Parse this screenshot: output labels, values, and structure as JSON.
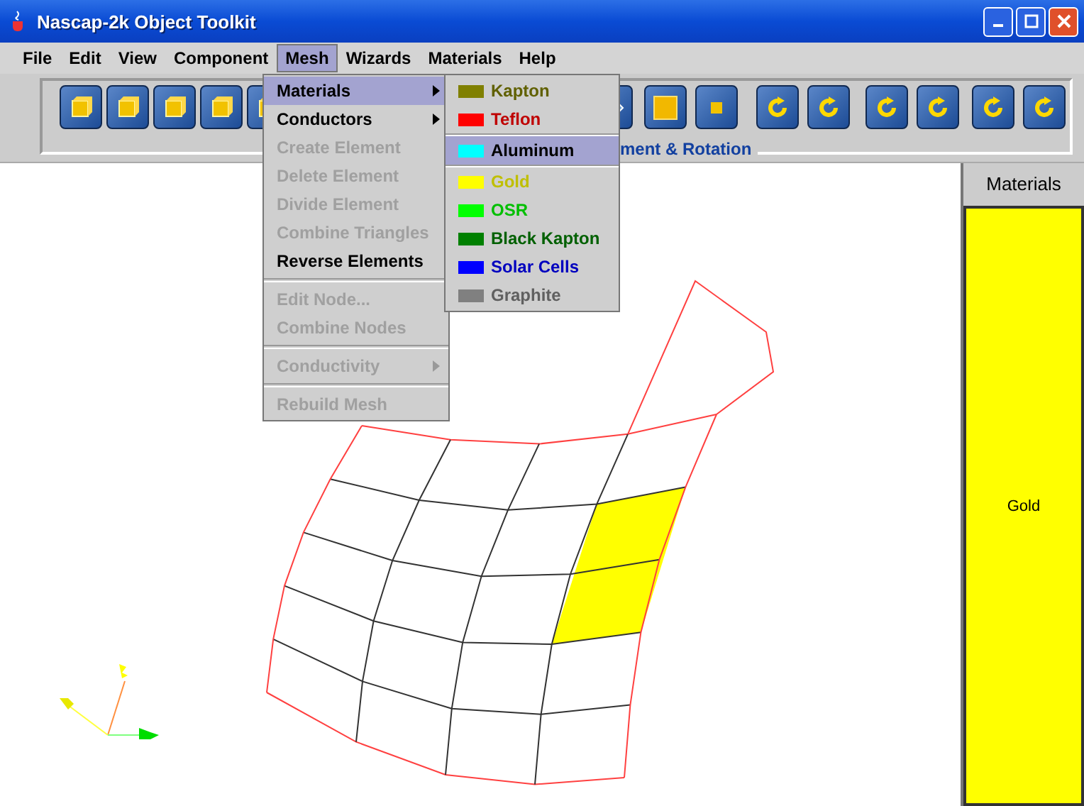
{
  "window": {
    "title": "Nascap-2k Object Toolkit"
  },
  "menubar": [
    {
      "label": "File",
      "selected": false
    },
    {
      "label": "Edit",
      "selected": false
    },
    {
      "label": "View",
      "selected": false
    },
    {
      "label": "Component",
      "selected": false
    },
    {
      "label": "Mesh",
      "selected": true
    },
    {
      "label": "Wizards",
      "selected": false
    },
    {
      "label": "Materials",
      "selected": false
    },
    {
      "label": "Help",
      "selected": false
    }
  ],
  "toolbar_group": {
    "title": "ment & Rotation"
  },
  "mesh_menu": {
    "items": [
      {
        "kind": "item",
        "label": "Materials",
        "disabled": false,
        "submenu": true,
        "selected": true
      },
      {
        "kind": "item",
        "label": "Conductors",
        "disabled": false,
        "submenu": true,
        "selected": false
      },
      {
        "kind": "item",
        "label": "Create Element",
        "disabled": true,
        "submenu": false,
        "selected": false
      },
      {
        "kind": "item",
        "label": "Delete Element",
        "disabled": true,
        "submenu": false,
        "selected": false
      },
      {
        "kind": "item",
        "label": "Divide Element",
        "disabled": true,
        "submenu": false,
        "selected": false
      },
      {
        "kind": "item",
        "label": "Combine Triangles",
        "disabled": true,
        "submenu": false,
        "selected": false
      },
      {
        "kind": "item",
        "label": "Reverse Elements",
        "disabled": false,
        "submenu": false,
        "selected": false
      },
      {
        "kind": "separator"
      },
      {
        "kind": "item",
        "label": "Edit Node...",
        "disabled": true,
        "submenu": false,
        "selected": false
      },
      {
        "kind": "item",
        "label": "Combine Nodes",
        "disabled": true,
        "submenu": false,
        "selected": false
      },
      {
        "kind": "separator"
      },
      {
        "kind": "item",
        "label": "Conductivity",
        "disabled": true,
        "submenu": true,
        "selected": false
      },
      {
        "kind": "separator"
      },
      {
        "kind": "item",
        "label": "Rebuild Mesh",
        "disabled": true,
        "submenu": false,
        "selected": false
      }
    ]
  },
  "materials_submenu": {
    "items": [
      {
        "kind": "item",
        "label": "Kapton",
        "color": "#808000",
        "selected": false
      },
      {
        "kind": "item",
        "label": "Teflon",
        "color": "#ff0000",
        "selected": false
      },
      {
        "kind": "separator"
      },
      {
        "kind": "item",
        "label": "Aluminum",
        "color": "#00ffff",
        "selected": true
      },
      {
        "kind": "separator"
      },
      {
        "kind": "item",
        "label": "Gold",
        "color": "#ffff00",
        "selected": false
      },
      {
        "kind": "item",
        "label": "OSR",
        "color": "#00ff00",
        "selected": false
      },
      {
        "kind": "item",
        "label": "Black Kapton",
        "color": "#008000",
        "selected": false
      },
      {
        "kind": "item",
        "label": "Solar Cells",
        "color": "#0000ff",
        "selected": false
      },
      {
        "kind": "item",
        "label": "Graphite",
        "color": "#808080",
        "selected": false
      }
    ]
  },
  "materials_panel": {
    "title": "Materials",
    "material": "Gold",
    "color": "#ffff00"
  }
}
